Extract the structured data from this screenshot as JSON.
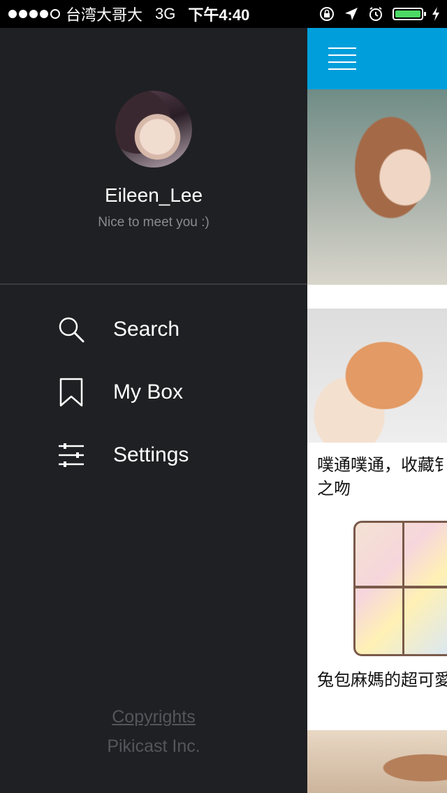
{
  "status_bar": {
    "carrier": "台湾大哥大",
    "network": "3G",
    "time": "下午4:40",
    "battery_level": 1.0,
    "battery_color": "#4cd964"
  },
  "profile": {
    "username": "Eileen_Lee",
    "tagline": "Nice to meet you :)"
  },
  "menu": {
    "items": [
      {
        "label": "Search",
        "icon": "search-icon"
      },
      {
        "label": "My Box",
        "icon": "bookmark-icon"
      },
      {
        "label": "Settings",
        "icon": "sliders-icon"
      }
    ]
  },
  "footer": {
    "copyrights": "Copyrights",
    "company": "Pikicast Inc."
  },
  "feed": {
    "navbar_color": "#009fdb",
    "cards": [
      {
        "title_line1": "噗通噗通，收藏钅",
        "title_line2": "之吻"
      },
      {
        "title": "兔包麻媽的超可愛"
      }
    ]
  }
}
